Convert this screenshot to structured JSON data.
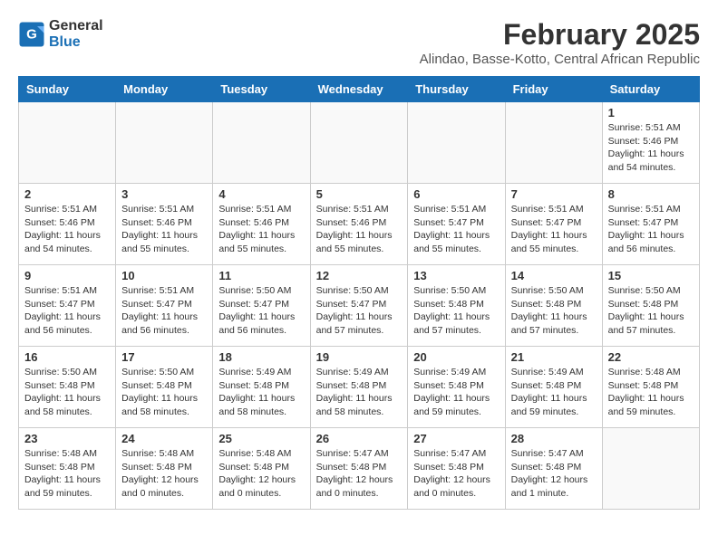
{
  "logo": {
    "line1": "General",
    "line2": "Blue"
  },
  "title": "February 2025",
  "subtitle": "Alindao, Basse-Kotto, Central African Republic",
  "days_of_week": [
    "Sunday",
    "Monday",
    "Tuesday",
    "Wednesday",
    "Thursday",
    "Friday",
    "Saturday"
  ],
  "weeks": [
    [
      {
        "day": "",
        "info": ""
      },
      {
        "day": "",
        "info": ""
      },
      {
        "day": "",
        "info": ""
      },
      {
        "day": "",
        "info": ""
      },
      {
        "day": "",
        "info": ""
      },
      {
        "day": "",
        "info": ""
      },
      {
        "day": "1",
        "info": "Sunrise: 5:51 AM\nSunset: 5:46 PM\nDaylight: 11 hours\nand 54 minutes."
      }
    ],
    [
      {
        "day": "2",
        "info": "Sunrise: 5:51 AM\nSunset: 5:46 PM\nDaylight: 11 hours\nand 54 minutes."
      },
      {
        "day": "3",
        "info": "Sunrise: 5:51 AM\nSunset: 5:46 PM\nDaylight: 11 hours\nand 55 minutes."
      },
      {
        "day": "4",
        "info": "Sunrise: 5:51 AM\nSunset: 5:46 PM\nDaylight: 11 hours\nand 55 minutes."
      },
      {
        "day": "5",
        "info": "Sunrise: 5:51 AM\nSunset: 5:46 PM\nDaylight: 11 hours\nand 55 minutes."
      },
      {
        "day": "6",
        "info": "Sunrise: 5:51 AM\nSunset: 5:47 PM\nDaylight: 11 hours\nand 55 minutes."
      },
      {
        "day": "7",
        "info": "Sunrise: 5:51 AM\nSunset: 5:47 PM\nDaylight: 11 hours\nand 55 minutes."
      },
      {
        "day": "8",
        "info": "Sunrise: 5:51 AM\nSunset: 5:47 PM\nDaylight: 11 hours\nand 56 minutes."
      }
    ],
    [
      {
        "day": "9",
        "info": "Sunrise: 5:51 AM\nSunset: 5:47 PM\nDaylight: 11 hours\nand 56 minutes."
      },
      {
        "day": "10",
        "info": "Sunrise: 5:51 AM\nSunset: 5:47 PM\nDaylight: 11 hours\nand 56 minutes."
      },
      {
        "day": "11",
        "info": "Sunrise: 5:50 AM\nSunset: 5:47 PM\nDaylight: 11 hours\nand 56 minutes."
      },
      {
        "day": "12",
        "info": "Sunrise: 5:50 AM\nSunset: 5:47 PM\nDaylight: 11 hours\nand 57 minutes."
      },
      {
        "day": "13",
        "info": "Sunrise: 5:50 AM\nSunset: 5:48 PM\nDaylight: 11 hours\nand 57 minutes."
      },
      {
        "day": "14",
        "info": "Sunrise: 5:50 AM\nSunset: 5:48 PM\nDaylight: 11 hours\nand 57 minutes."
      },
      {
        "day": "15",
        "info": "Sunrise: 5:50 AM\nSunset: 5:48 PM\nDaylight: 11 hours\nand 57 minutes."
      }
    ],
    [
      {
        "day": "16",
        "info": "Sunrise: 5:50 AM\nSunset: 5:48 PM\nDaylight: 11 hours\nand 58 minutes."
      },
      {
        "day": "17",
        "info": "Sunrise: 5:50 AM\nSunset: 5:48 PM\nDaylight: 11 hours\nand 58 minutes."
      },
      {
        "day": "18",
        "info": "Sunrise: 5:49 AM\nSunset: 5:48 PM\nDaylight: 11 hours\nand 58 minutes."
      },
      {
        "day": "19",
        "info": "Sunrise: 5:49 AM\nSunset: 5:48 PM\nDaylight: 11 hours\nand 58 minutes."
      },
      {
        "day": "20",
        "info": "Sunrise: 5:49 AM\nSunset: 5:48 PM\nDaylight: 11 hours\nand 59 minutes."
      },
      {
        "day": "21",
        "info": "Sunrise: 5:49 AM\nSunset: 5:48 PM\nDaylight: 11 hours\nand 59 minutes."
      },
      {
        "day": "22",
        "info": "Sunrise: 5:48 AM\nSunset: 5:48 PM\nDaylight: 11 hours\nand 59 minutes."
      }
    ],
    [
      {
        "day": "23",
        "info": "Sunrise: 5:48 AM\nSunset: 5:48 PM\nDaylight: 11 hours\nand 59 minutes."
      },
      {
        "day": "24",
        "info": "Sunrise: 5:48 AM\nSunset: 5:48 PM\nDaylight: 12 hours\nand 0 minutes."
      },
      {
        "day": "25",
        "info": "Sunrise: 5:48 AM\nSunset: 5:48 PM\nDaylight: 12 hours\nand 0 minutes."
      },
      {
        "day": "26",
        "info": "Sunrise: 5:47 AM\nSunset: 5:48 PM\nDaylight: 12 hours\nand 0 minutes."
      },
      {
        "day": "27",
        "info": "Sunrise: 5:47 AM\nSunset: 5:48 PM\nDaylight: 12 hours\nand 0 minutes."
      },
      {
        "day": "28",
        "info": "Sunrise: 5:47 AM\nSunset: 5:48 PM\nDaylight: 12 hours\nand 1 minute."
      },
      {
        "day": "",
        "info": ""
      }
    ]
  ]
}
